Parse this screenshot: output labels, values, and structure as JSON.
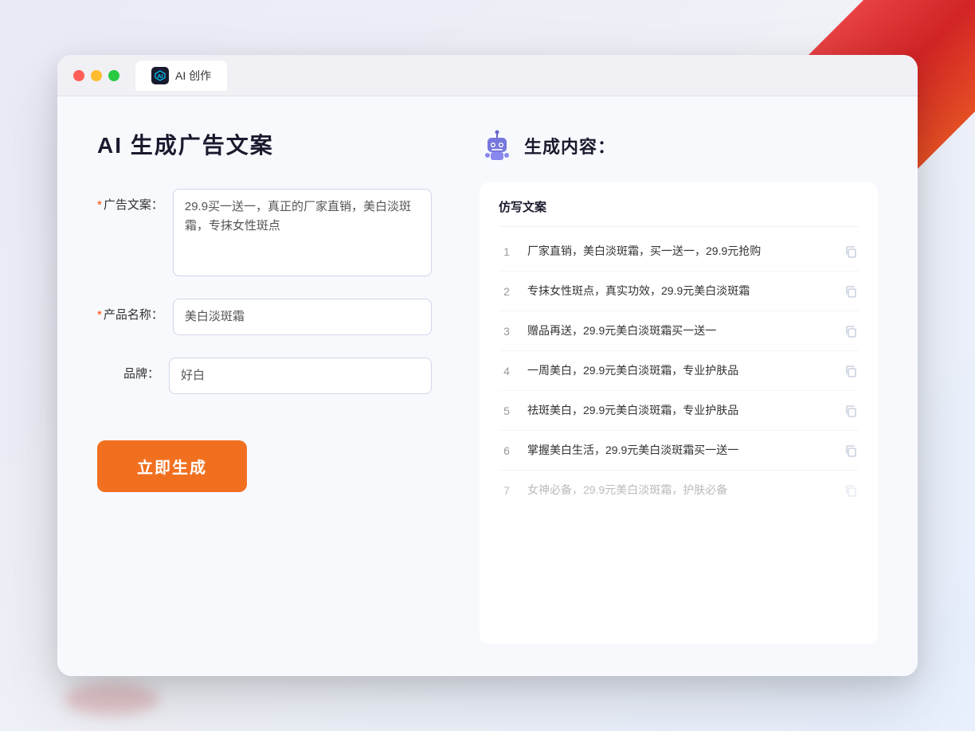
{
  "window": {
    "tab_label": "AI 创作"
  },
  "page": {
    "title": "AI 生成广告文案",
    "generate_button_label": "立即生成"
  },
  "form": {
    "ad_copy_label": "广告文案：",
    "ad_copy_required": "*",
    "ad_copy_value": "29.9买一送一，真正的厂家直销，美白淡斑霜，专抹女性斑点",
    "product_name_label": "产品名称：",
    "product_name_required": "*",
    "product_name_value": "美白淡斑霜",
    "brand_label": "品牌：",
    "brand_value": "好白"
  },
  "results": {
    "section_title": "生成内容：",
    "column_header": "仿写文案",
    "items": [
      {
        "num": "1",
        "text": "厂家直销，美白淡斑霜，买一送一，29.9元抢购",
        "faded": false
      },
      {
        "num": "2",
        "text": "专抹女性斑点，真实功效，29.9元美白淡斑霜",
        "faded": false
      },
      {
        "num": "3",
        "text": "赠品再送，29.9元美白淡斑霜买一送一",
        "faded": false
      },
      {
        "num": "4",
        "text": "一周美白，29.9元美白淡斑霜，专业护肤品",
        "faded": false
      },
      {
        "num": "5",
        "text": "祛斑美白，29.9元美白淡斑霜，专业护肤品",
        "faded": false
      },
      {
        "num": "6",
        "text": "掌握美白生活，29.9元美白淡斑霜买一送一",
        "faded": false
      },
      {
        "num": "7",
        "text": "女神必备，29.9元美白淡斑霜，护肤必备",
        "faded": true
      }
    ]
  },
  "colors": {
    "orange": "#f07020",
    "blue_accent": "#4a90e2",
    "required_red": "#ff4400"
  }
}
